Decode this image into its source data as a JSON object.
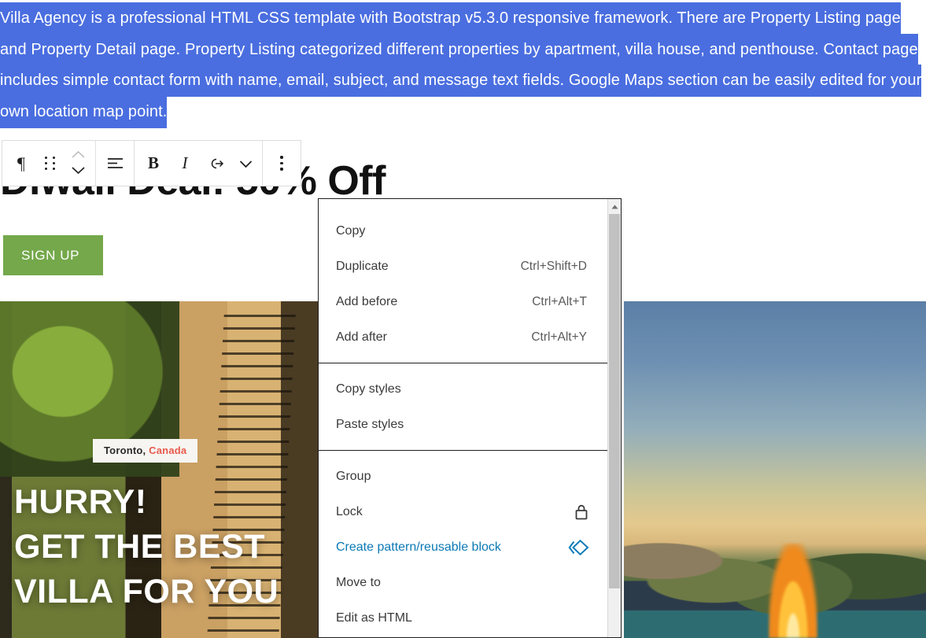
{
  "editor": {
    "selected_paragraph": "Villa Agency is a professional HTML CSS template with Bootstrap v5.3.0 responsive framework. There are Property Listing page and Property Detail page. Property Listing categorized different properties by apartment, villa house, and penthouse. Contact page includes simple contact form with name, email, subject, and message text fields. Google Maps section can be easily edited for your own location map point.",
    "selection_color": "#4a6ee0",
    "heading": "Diwali Deal: 50% Off",
    "signup_label": "SIGN UP",
    "signup_color": "#74a84b"
  },
  "block_toolbar": {
    "groups": [
      {
        "buttons": [
          {
            "name": "paragraph-block-type-button",
            "icon": "pilcrow-icon",
            "label": "¶"
          },
          {
            "name": "drag-handle-button",
            "icon": "drag-dots-icon",
            "label": ""
          },
          {
            "name": "move-up-button",
            "icon": "chevron-up-icon",
            "label": "",
            "disabled": true
          },
          {
            "name": "move-down-button",
            "icon": "chevron-down-icon",
            "label": "",
            "disabled": false
          }
        ]
      },
      {
        "buttons": [
          {
            "name": "align-text-button",
            "icon": "align-left-icon",
            "label": ""
          }
        ]
      },
      {
        "buttons": [
          {
            "name": "bold-button",
            "icon": "bold-icon",
            "label": "B"
          },
          {
            "name": "italic-button",
            "icon": "italic-icon",
            "label": "I"
          },
          {
            "name": "link-button",
            "icon": "link-icon",
            "label": ""
          },
          {
            "name": "more-rich-text-button",
            "icon": "chevron-down-icon",
            "label": ""
          }
        ]
      },
      {
        "buttons": [
          {
            "name": "block-options-button",
            "icon": "vertical-ellipsis-icon",
            "label": ""
          }
        ]
      }
    ]
  },
  "context_menu": {
    "sections": [
      {
        "items": [
          {
            "label": "Copy",
            "shortcut": "",
            "icon": "",
            "highlight": false
          },
          {
            "label": "Duplicate",
            "shortcut": "Ctrl+Shift+D",
            "icon": "",
            "highlight": false
          },
          {
            "label": "Add before",
            "shortcut": "Ctrl+Alt+T",
            "icon": "",
            "highlight": false
          },
          {
            "label": "Add after",
            "shortcut": "Ctrl+Alt+Y",
            "icon": "",
            "highlight": false
          }
        ]
      },
      {
        "items": [
          {
            "label": "Copy styles",
            "shortcut": "",
            "icon": "",
            "highlight": false
          },
          {
            "label": "Paste styles",
            "shortcut": "",
            "icon": "",
            "highlight": false
          }
        ]
      },
      {
        "items": [
          {
            "label": "Group",
            "shortcut": "",
            "icon": "",
            "highlight": false
          },
          {
            "label": "Lock",
            "shortcut": "",
            "icon": "lock-icon",
            "highlight": false
          },
          {
            "label": "Create pattern/reusable block",
            "shortcut": "",
            "icon": "reusable-block-icon",
            "highlight": true
          },
          {
            "label": "Move to",
            "shortcut": "",
            "icon": "",
            "highlight": false
          },
          {
            "label": "Edit as HTML",
            "shortcut": "",
            "icon": "",
            "highlight": false
          }
        ]
      }
    ],
    "highlight_color": "#0c7ab5",
    "scrollbar": {
      "up_arrow_icon": "triangle-up-icon"
    }
  },
  "photos": {
    "left": {
      "badge_city": "Toronto,",
      "badge_country": " Canada",
      "hero_text": "HURRY!\nGET THE BEST\nVILLA FOR YOU",
      "badge_country_color": "#e75b4c"
    },
    "right": {
      "alt": "villa at sunset with pool and fire feature"
    }
  }
}
